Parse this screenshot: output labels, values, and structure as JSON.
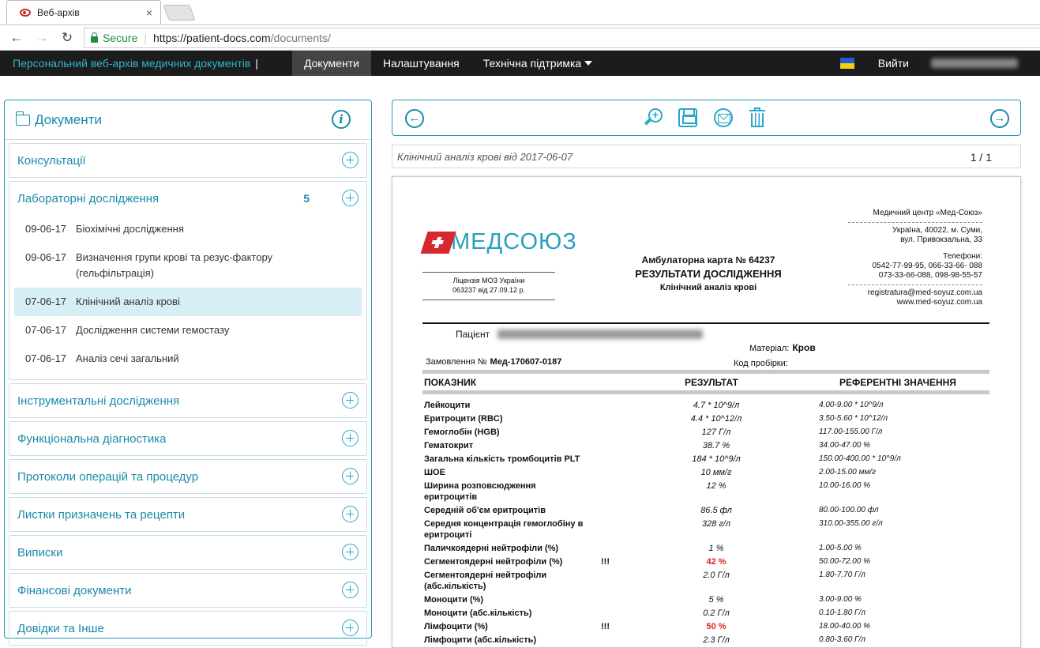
{
  "browser": {
    "tab_title": "Веб-архів",
    "tab_close": "×",
    "secure_label": "Secure",
    "url_host": "https://patient-docs.com",
    "url_path": "/documents/"
  },
  "app": {
    "brand": "Персональний веб-архів медичних документів",
    "brand_separator": "|",
    "menu": {
      "documents": "Документи",
      "settings": "Налаштування",
      "support": "Технічна підтримка"
    },
    "logout": "Вийти"
  },
  "sidebar": {
    "title": "Документи",
    "info_glyph": "i",
    "categories": [
      {
        "label": "Консультації"
      },
      {
        "label": "Лабораторні дослідження",
        "count": "5"
      },
      {
        "label": "Інструментальні дослідження"
      },
      {
        "label": "Функціональна діагностика"
      },
      {
        "label": "Протоколи операцій та процедур"
      },
      {
        "label": "Листки призначень та рецепти"
      },
      {
        "label": "Виписки"
      },
      {
        "label": "Фінансові документи"
      },
      {
        "label": "Довідки та Інше"
      }
    ],
    "lab_docs": [
      {
        "date": "09-06-17",
        "title": "Біохімічні дослідження"
      },
      {
        "date": "09-06-17",
        "title": "Визначення групи крові та резус-фактору (гельфільтрація)"
      },
      {
        "date": "07-06-17",
        "title": "Клінічний аналіз крові"
      },
      {
        "date": "07-06-17",
        "title": "Дослідження системи гемостазу"
      },
      {
        "date": "07-06-17",
        "title": "Аналіз сечі загальний"
      }
    ]
  },
  "viewer": {
    "prev_glyph": "←",
    "next_glyph": "→",
    "zoom_glyph": "+",
    "doc_title": "Клінічний аналіз крові від 2017-06-07",
    "page_indicator": "1 / 1"
  },
  "report": {
    "logo_text": "МЕДСОЮЗ",
    "license_line1": "Ліцензія МОЗ України",
    "license_line2": "063237 від 27.09.12 р.",
    "card": "Амбулаторна карта № 64237",
    "results_title": "РЕЗУЛЬТАТИ ДОСЛІДЖЕННЯ",
    "analysis": "Клінічний аналіз крові",
    "clinic_name": "Медичний центр «Мед-Союз»",
    "address_line1": "Україна, 40022, м. Суми,",
    "address_line2": "вул. Привокзальна, 33",
    "phones_label": "Телефони:",
    "phones_line1": "0542-77-99-95, 066-33-66- 088",
    "phones_line2": "073-33-66-088, 098-98-55-57",
    "email": "registratura@med-soyuz.com.ua",
    "website": "www.med-soyuz.com.ua",
    "patient_label": "Пацієнт",
    "material_label": "Матеріал:",
    "material_value": "Кров",
    "order_label": "Замовлення №",
    "order_value": "Мед-170607-0187",
    "tube_label": "Код пробірки:",
    "col_indicator": "ПОКАЗНИК",
    "col_result": "РЕЗУЛЬТАТ",
    "col_reference": "РЕФЕРЕНТНІ ЗНАЧЕННЯ",
    "rows": [
      {
        "name": "Лейкоцити",
        "result": "4.7 * 10^9/л",
        "ref": "4.00-9.00 * 10^9/л"
      },
      {
        "name": "Еритроцити (RBC)",
        "result": "4.4 * 10^12/л",
        "ref": "3.50-5.60 * 10^12/л"
      },
      {
        "name": "Гемоглобін (HGB)",
        "result": "127 Г/л",
        "ref": "117.00-155.00 Г/л"
      },
      {
        "name": "Гематокрит",
        "result": "38.7 %",
        "ref": "34.00-47.00 %"
      },
      {
        "name": "Загальна кількість тромбоцитів PLT",
        "result": "184 * 10^9/л",
        "ref": "150.00-400.00 * 10^9/л"
      },
      {
        "name": "ШОЕ",
        "result": "10 мм/г",
        "ref": "2.00-15.00 мм/г"
      },
      {
        "name": "Ширина розповсюдження еритроцитів",
        "result": "12 %",
        "ref": "10.00-16.00 %"
      },
      {
        "name": "Середній об'єм еритроцитів",
        "result": "86.5 фл",
        "ref": "80.00-100.00 фл"
      },
      {
        "name": "Середня концентрація гемоглобіну в еритроциті",
        "result": "328 г/л",
        "ref": "310.00-355.00 г/л"
      },
      {
        "name": "Паличкоядерні нейтрофіли (%)",
        "result": "1 %",
        "ref": "1.00-5.00 %"
      },
      {
        "name": "Сегментоядерні нейтрофіли (%)",
        "flag": "!!!",
        "result": "42 %",
        "alert": true,
        "ref": "50.00-72.00 %"
      },
      {
        "name": "Сегментоядерні нейтрофіли (абс.кількість)",
        "result": "2.0 Г/л",
        "ref": "1.80-7.70 Г/л"
      },
      {
        "name": "Моноцити (%)",
        "result": "5 %",
        "ref": "3.00-9.00 %"
      },
      {
        "name": "Моноцити  (абс.кількість)",
        "result": "0.2 Г/л",
        "ref": "0.10-1.80 Г/л"
      },
      {
        "name": "Лімфоцити (%)",
        "flag": "!!!",
        "result": "50 %",
        "alert": true,
        "ref": "18.00-40.00 %"
      },
      {
        "name": "Лімфоцити  (абс.кількість)",
        "result": "2.3 Г/л",
        "ref": "0.80-3.60 Г/л"
      }
    ]
  },
  "colors": {
    "accent": "#1a8aab",
    "nav_bg": "#1c1c1c",
    "alert": "#e02020"
  }
}
